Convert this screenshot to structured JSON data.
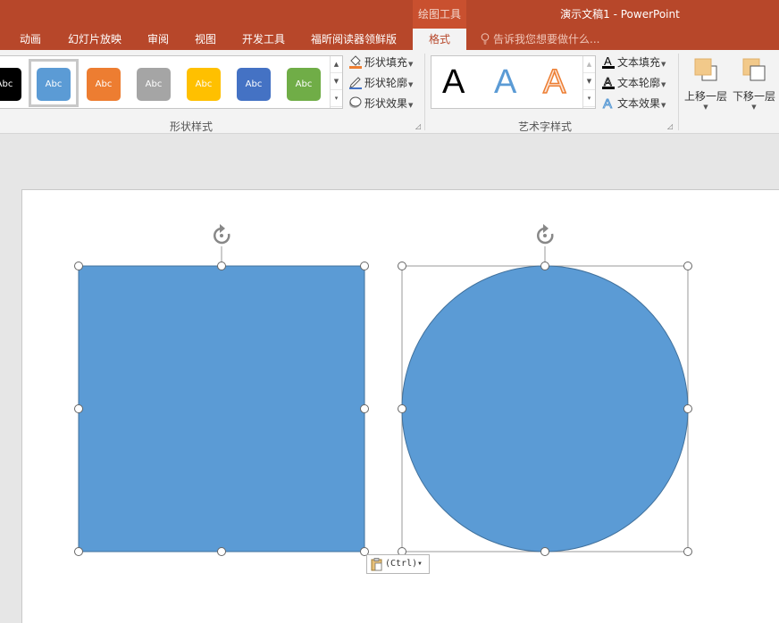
{
  "titlebar": {
    "context_group": "绘图工具",
    "app_title": "演示文稿1 - PowerPoint",
    "tabs": [
      "动画",
      "幻灯片放映",
      "审阅",
      "视图",
      "开发工具",
      "福昕阅读器领鲜版",
      "格式"
    ],
    "tell_me": "告诉我您想要做什么..."
  },
  "ribbon": {
    "shape_styles": {
      "swatch_label": "Abc",
      "swatch_colors": [
        "#000000",
        "#5b9bd5",
        "#ed7d31",
        "#a5a5a5",
        "#ffc000",
        "#4472c4",
        "#70ad47"
      ],
      "fill": "形状填充",
      "outline": "形状轮廓",
      "effects": "形状效果",
      "group_label": "形状样式"
    },
    "wordart_styles": {
      "letter": "A",
      "text_fill": "文本填充",
      "text_outline": "文本轮廓",
      "text_effects": "文本效果",
      "group_label": "艺术字样式"
    },
    "arrange": {
      "bring_forward": "上移一层",
      "send_backward": "下移一层"
    }
  },
  "slide": {
    "shape_fill_color": "#5b9bd5",
    "shape_outline_color": "#41719c",
    "paste_options_label": "(Ctrl)"
  }
}
